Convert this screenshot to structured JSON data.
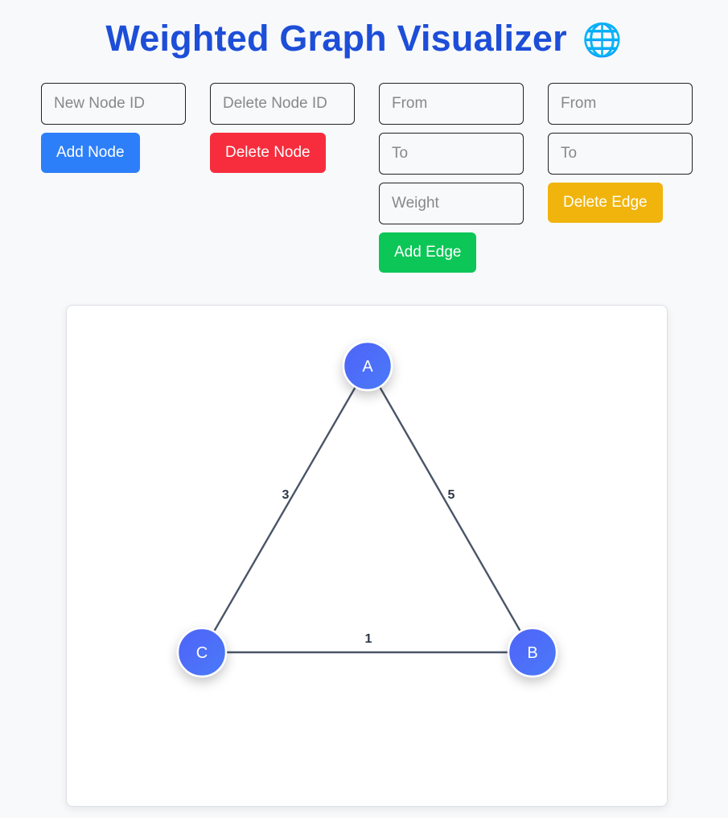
{
  "header": {
    "title": "Weighted Graph Visualizer",
    "emoji": "🌐",
    "emoji_name": "globe-icon"
  },
  "controls": {
    "add_node": {
      "placeholder": "New Node ID",
      "value": "",
      "button": "Add Node"
    },
    "delete_node": {
      "placeholder": "Delete Node ID",
      "value": "",
      "button": "Delete Node"
    },
    "add_edge": {
      "from_placeholder": "From",
      "to_placeholder": "To",
      "weight_placeholder": "Weight",
      "button": "Add Edge"
    },
    "delete_edge": {
      "from_placeholder": "From",
      "to_placeholder": "To",
      "button": "Delete Edge"
    }
  },
  "colors": {
    "title": "#1d4ed8",
    "add_node": "#2d7ff9",
    "delete_node": "#f72d3d",
    "add_edge": "#0cc657",
    "delete_edge": "#f1b40c",
    "node_fill_start": "#4f63f7",
    "node_fill_end": "#4b7af9",
    "edge": "#4a5568"
  },
  "graph": {
    "nodes": [
      {
        "id": "A"
      },
      {
        "id": "B"
      },
      {
        "id": "C"
      }
    ],
    "edges": [
      {
        "from": "A",
        "to": "C",
        "weight": "3"
      },
      {
        "from": "A",
        "to": "B",
        "weight": "5"
      },
      {
        "from": "C",
        "to": "B",
        "weight": "1"
      }
    ]
  }
}
